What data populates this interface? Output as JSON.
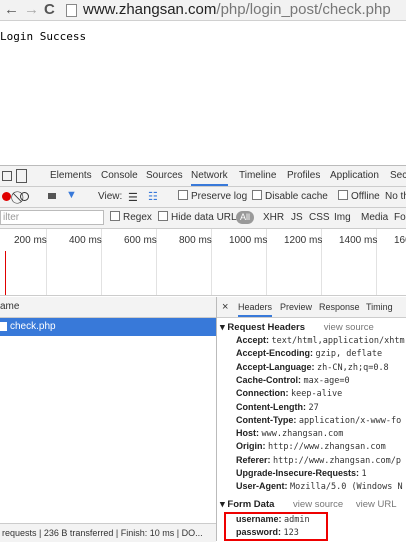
{
  "browser": {
    "back_icon": "←",
    "forward_icon": "→",
    "reload_icon": "C",
    "url_domain": "www.zhangsan.com",
    "url_path": "/php/login_post/check.php"
  },
  "page": {
    "text": "Login Success"
  },
  "devtools": {
    "tabs": [
      "Elements",
      "Console",
      "Sources",
      "Network",
      "Timeline",
      "Profiles",
      "Application",
      "Secu"
    ],
    "active_tab": "Network",
    "toolbar": {
      "view_label": "View:",
      "preserve_log": "Preserve log",
      "disable_cache": "Disable cache",
      "offline": "Offline",
      "no_throttling": "No th"
    },
    "filter": {
      "placeholder": "ilter",
      "regex": "Regex",
      "hide_data_urls": "Hide data URLs",
      "types": [
        "All",
        "XHR",
        "JS",
        "CSS",
        "Img",
        "Media",
        "Fo"
      ]
    },
    "timeline_ticks": [
      "200 ms",
      "400 ms",
      "600 ms",
      "800 ms",
      "1000 ms",
      "1200 ms",
      "1400 ms",
      "160"
    ],
    "list": {
      "header": "ame",
      "selected_file": "check.php"
    },
    "status": "requests | 236 B transferred | Finish: 10 ms | DO...",
    "detail": {
      "close": "×",
      "tabs": [
        "Headers",
        "Preview",
        "Response",
        "Timing"
      ],
      "request_headers_title": "Request Headers",
      "view_source": "view source",
      "headers": [
        {
          "k": "Accept:",
          "v": "text/html,application/xhtm"
        },
        {
          "k": "Accept-Encoding:",
          "v": "gzip, deflate"
        },
        {
          "k": "Accept-Language:",
          "v": "zh-CN,zh;q=0.8"
        },
        {
          "k": "Cache-Control:",
          "v": "max-age=0"
        },
        {
          "k": "Connection:",
          "v": "keep-alive"
        },
        {
          "k": "Content-Length:",
          "v": "27"
        },
        {
          "k": "Content-Type:",
          "v": "application/x-www-fo"
        },
        {
          "k": "Host:",
          "v": "www.zhangsan.com"
        },
        {
          "k": "Origin:",
          "v": "http://www.zhangsan.com"
        },
        {
          "k": "Referer:",
          "v": "http://www.zhangsan.com/p"
        },
        {
          "k": "Upgrade-Insecure-Requests:",
          "v": "1"
        },
        {
          "k": "User-Agent:",
          "v": "Mozilla/5.0 (Windows N"
        }
      ],
      "form_data_title": "Form Data",
      "view_url": "view URL",
      "form": [
        {
          "k": "username:",
          "v": "admin"
        },
        {
          "k": "password:",
          "v": "123"
        }
      ]
    }
  },
  "colors": {
    "accent": "#3879d9",
    "record": "#e00000",
    "highlight": "#e00000"
  }
}
